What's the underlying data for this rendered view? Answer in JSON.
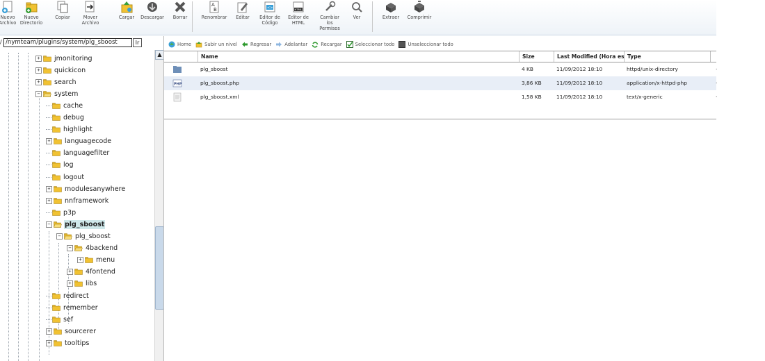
{
  "toolbar": {
    "buttons": [
      {
        "label": "Nuevo\nArchivo",
        "icon": "new-file-icon"
      },
      {
        "label": "Nuevo\nDirectorio",
        "icon": "new-folder-icon"
      },
      {
        "label": "Copiar",
        "icon": "copy-icon"
      },
      {
        "label": "Mover\nArchivo",
        "icon": "move-icon"
      },
      {
        "label": "Cargar",
        "icon": "upload-icon"
      },
      {
        "label": "Descargar",
        "icon": "download-icon"
      },
      {
        "label": "Borrar",
        "icon": "delete-icon"
      },
      {
        "label": "Renombrar",
        "icon": "rename-icon"
      },
      {
        "label": "Editar",
        "icon": "edit-icon"
      },
      {
        "label": "Editor de\nCódigo",
        "icon": "code-editor-icon"
      },
      {
        "label": "Editor de\nHTML",
        "icon": "html-editor-icon"
      },
      {
        "label": "Cambiar\nlos\nPermisos",
        "icon": "permissions-icon"
      },
      {
        "label": "Ver",
        "icon": "view-icon"
      },
      {
        "label": "Extraer",
        "icon": "extract-icon"
      },
      {
        "label": "Comprimir",
        "icon": "compress-icon"
      }
    ]
  },
  "left_pane": {
    "path_value": "/nymteam/plugins/system/plg_sboost",
    "go_label": "Ir",
    "tree": [
      {
        "label": "jmonitoring",
        "toggle": "+",
        "selected": false
      },
      {
        "label": "quickicon",
        "toggle": "+",
        "selected": false
      },
      {
        "label": "search",
        "toggle": "+",
        "selected": false
      },
      {
        "label": "system",
        "toggle": "-",
        "selected": false
      },
      {
        "label": "cache",
        "toggle": "",
        "selected": false
      },
      {
        "label": "debug",
        "toggle": "",
        "selected": false
      },
      {
        "label": "highlight",
        "toggle": "",
        "selected": false
      },
      {
        "label": "languagecode",
        "toggle": "+",
        "selected": false
      },
      {
        "label": "languagefilter",
        "toggle": "",
        "selected": false
      },
      {
        "label": "log",
        "toggle": "",
        "selected": false
      },
      {
        "label": "logout",
        "toggle": "",
        "selected": false
      },
      {
        "label": "modulesanywhere",
        "toggle": "+",
        "selected": false
      },
      {
        "label": "nnframework",
        "toggle": "+",
        "selected": false
      },
      {
        "label": "p3p",
        "toggle": "",
        "selected": false
      },
      {
        "label": "plg_sboost",
        "toggle": "-",
        "selected": true
      },
      {
        "label": "plg_sboost",
        "toggle": "-",
        "selected": false
      },
      {
        "label": "4backend",
        "toggle": "-",
        "selected": false
      },
      {
        "label": "menu",
        "toggle": "+",
        "selected": false
      },
      {
        "label": "4fontend",
        "toggle": "+",
        "selected": false
      },
      {
        "label": "libs",
        "toggle": "+",
        "selected": false
      },
      {
        "label": "redirect",
        "toggle": "",
        "selected": false
      },
      {
        "label": "remember",
        "toggle": "",
        "selected": false
      },
      {
        "label": "sef",
        "toggle": "",
        "selected": false
      },
      {
        "label": "sourcerer",
        "toggle": "+",
        "selected": false
      },
      {
        "label": "tooltips",
        "toggle": "+",
        "selected": false
      }
    ],
    "scroll_up": "▲"
  },
  "navbar": {
    "home": "Home",
    "up": "Subir un nivel",
    "back": "Regresar",
    "forward": "Adelantar",
    "reload": "Recargar",
    "select_all": "Seleccionar todo",
    "unselect_all": "Unseleccionar todo"
  },
  "grid": {
    "headers": {
      "name": "Name",
      "size": "Size",
      "modified": "Last Modified (Hora est",
      "type": "Type"
    },
    "rows": [
      {
        "icon": "folder-icon",
        "name": "plg_sboost",
        "size": "4 KB",
        "modified": "11/09/2012 18:10",
        "type": "httpd/unix-directory"
      },
      {
        "icon": "php-file-icon",
        "name": "plg_sboost.php",
        "size": "3,86 KB",
        "modified": "11/09/2012 18:10",
        "type": "application/x-httpd-php"
      },
      {
        "icon": "xml-file-icon",
        "name": "plg_sboost.xml",
        "size": "1,58 KB",
        "modified": "11/09/2012 18:10",
        "type": "text/x-generic"
      }
    ]
  },
  "colors": {
    "folder": "#f1c232",
    "accent": "#3b7dd8",
    "selected_bg": "#cfe8ea",
    "alt_row": "#e8eef7"
  }
}
